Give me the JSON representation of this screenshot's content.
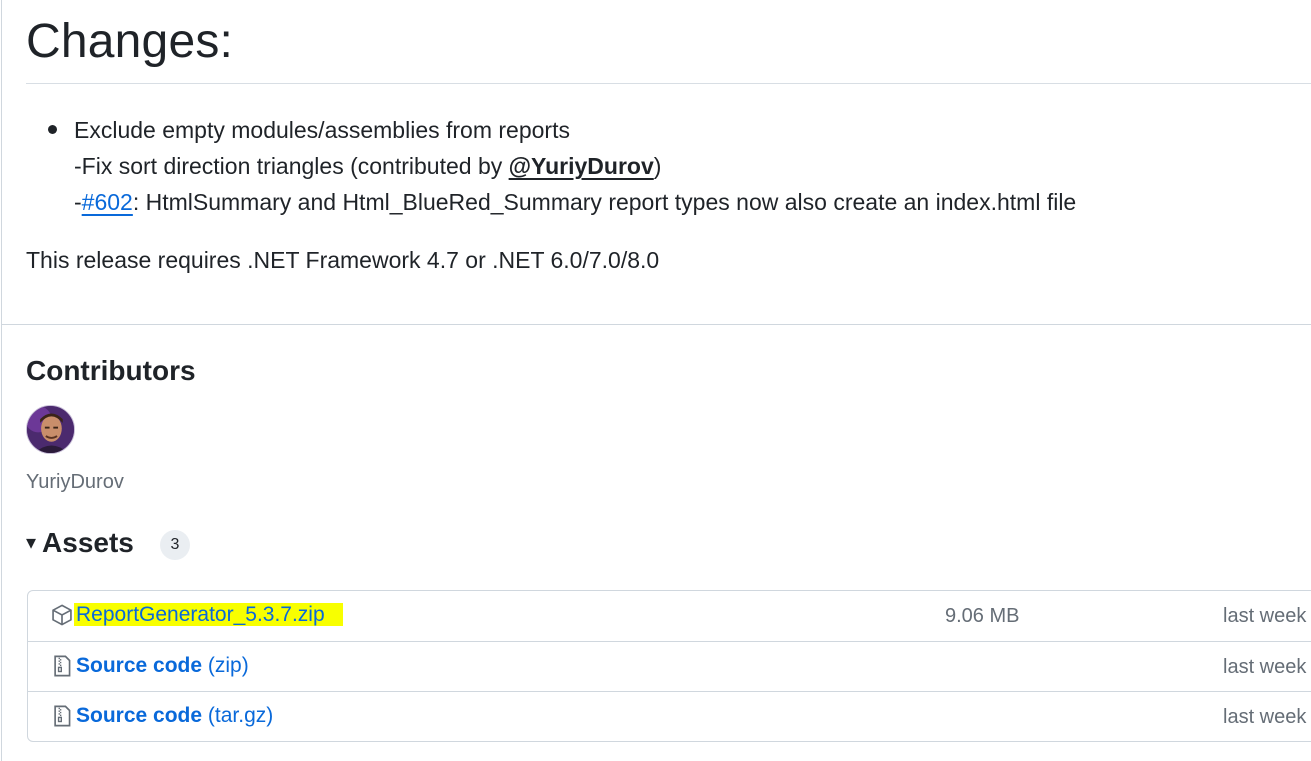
{
  "changes": {
    "title": "Changes:",
    "bullet": {
      "line1": "Exclude empty modules/assemblies from reports",
      "line2_prefix": "-Fix sort direction triangles (contributed by ",
      "line2_mention": "@YuriyDurov",
      "line2_suffix": ")",
      "line3_prefix": "-",
      "line3_issue": "#602",
      "line3_text": ": HtmlSummary and Html_BlueRed_Summary report types now also create an index.html file"
    },
    "requires": "This release requires .NET Framework 4.7 or .NET 6.0/7.0/8.0"
  },
  "contributors": {
    "title": "Contributors",
    "items": [
      {
        "name": "YuriyDurov"
      }
    ]
  },
  "assets": {
    "title": "Assets",
    "count": "3",
    "items": [
      {
        "icon": "package-icon",
        "name": "ReportGenerator_5.3.7.zip",
        "suffix": "",
        "size": "9.06 MB",
        "time": "last week",
        "highlighted": true
      },
      {
        "icon": "file-zip-icon",
        "name": "Source code",
        "suffix": "(zip)",
        "size": "",
        "time": "last week",
        "highlighted": false
      },
      {
        "icon": "file-zip-icon",
        "name": "Source code",
        "suffix": "(tar.gz)",
        "size": "",
        "time": "last week",
        "highlighted": false
      }
    ]
  },
  "colors": {
    "link": "#0969da",
    "text": "#1f2328",
    "muted": "#656d76",
    "border": "#d0d7de",
    "highlight": "#f8ff00"
  }
}
